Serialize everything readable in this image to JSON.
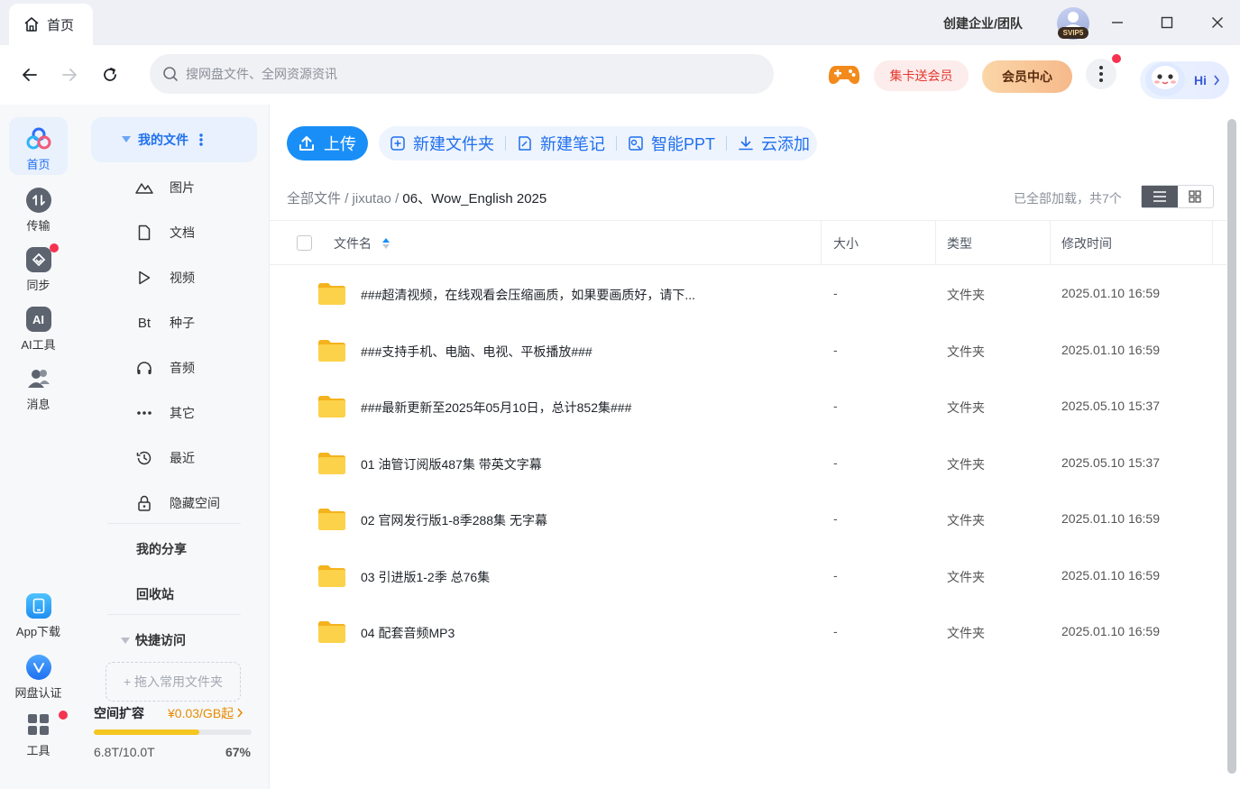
{
  "titlebar": {
    "tab_label": "首页",
    "create_team": "创建企业/团队",
    "svip_badge": "SVIP5"
  },
  "navbar": {
    "search_placeholder": "搜网盘文件、全网资源资讯",
    "card_vip": "集卡送会员",
    "member_center": "会员中心",
    "hi": "Hi"
  },
  "rail": {
    "items": [
      {
        "label": "首页",
        "icon": "home-cloud-icon"
      },
      {
        "label": "传输",
        "icon": "transfer-icon"
      },
      {
        "label": "同步",
        "icon": "sync-icon"
      },
      {
        "label": "AI工具",
        "icon": "ai-tools-icon"
      },
      {
        "label": "消息",
        "icon": "message-icon"
      },
      {
        "label": "App下载",
        "icon": "app-download-icon"
      },
      {
        "label": "网盘认证",
        "icon": "verify-icon"
      },
      {
        "label": "工具",
        "icon": "tools-icon"
      }
    ]
  },
  "sidebar": {
    "my_files": "我的文件",
    "items": [
      {
        "label": "图片",
        "icon": "image-icon"
      },
      {
        "label": "文档",
        "icon": "document-icon"
      },
      {
        "label": "视频",
        "icon": "video-icon"
      },
      {
        "label": "种子",
        "icon": "torrent-icon",
        "glyph": "Bt"
      },
      {
        "label": "音频",
        "icon": "audio-icon"
      },
      {
        "label": "其它",
        "icon": "other-icon"
      },
      {
        "label": "最近",
        "icon": "recent-icon"
      },
      {
        "label": "隐藏空间",
        "icon": "lock-icon"
      }
    ],
    "my_share": "我的分享",
    "recycle": "回收站",
    "quick_access": "快捷访问",
    "drop_hint": "+ 拖入常用文件夹",
    "capacity": {
      "title": "空间扩容",
      "price": "¥0.03/GB起",
      "used": "6.8T/10.0T",
      "percent_label": "67%",
      "fraction": 0.67
    }
  },
  "toolbar": {
    "upload": "上传",
    "actions": [
      {
        "label": "新建文件夹",
        "icon": "new-folder-icon"
      },
      {
        "label": "新建笔记",
        "icon": "new-note-icon"
      },
      {
        "label": "智能PPT",
        "icon": "smart-ppt-icon"
      },
      {
        "label": "云添加",
        "icon": "cloud-add-icon"
      }
    ]
  },
  "breadcrumb": {
    "root": "全部文件",
    "sep": "/",
    "level1": "jixutao",
    "current": "06、Wow_English 2025"
  },
  "loaded_status": "已全部加载，共7个",
  "table": {
    "headers": {
      "name": "文件名",
      "size": "大小",
      "type": "类型",
      "mtime": "修改时间"
    },
    "rows": [
      {
        "name": "###超清视频，在线观看会压缩画质，如果要画质好，请下...",
        "size": "-",
        "type": "文件夹",
        "mtime": "2025.01.10 16:59"
      },
      {
        "name": "###支持手机、电脑、电视、平板播放###",
        "size": "-",
        "type": "文件夹",
        "mtime": "2025.01.10 16:59"
      },
      {
        "name": "###最新更新至2025年05月10日，总计852集###",
        "size": "-",
        "type": "文件夹",
        "mtime": "2025.05.10 15:37"
      },
      {
        "name": "01 油管订阅版487集 带英文字幕",
        "size": "-",
        "type": "文件夹",
        "mtime": "2025.05.10 15:37"
      },
      {
        "name": "02 官网发行版1-8季288集 无字幕",
        "size": "-",
        "type": "文件夹",
        "mtime": "2025.01.10 16:59"
      },
      {
        "name": "03 引进版1-2季 总76集",
        "size": "-",
        "type": "文件夹",
        "mtime": "2025.01.10 16:59"
      },
      {
        "name": "04 配套音频MP3",
        "size": "-",
        "type": "文件夹",
        "mtime": "2025.01.10 16:59"
      }
    ]
  },
  "colors": {
    "accent": "#1a8ef7",
    "folder": "#f7c630",
    "badge_red": "#f5334f",
    "capacity_bar": "#f4c620"
  }
}
